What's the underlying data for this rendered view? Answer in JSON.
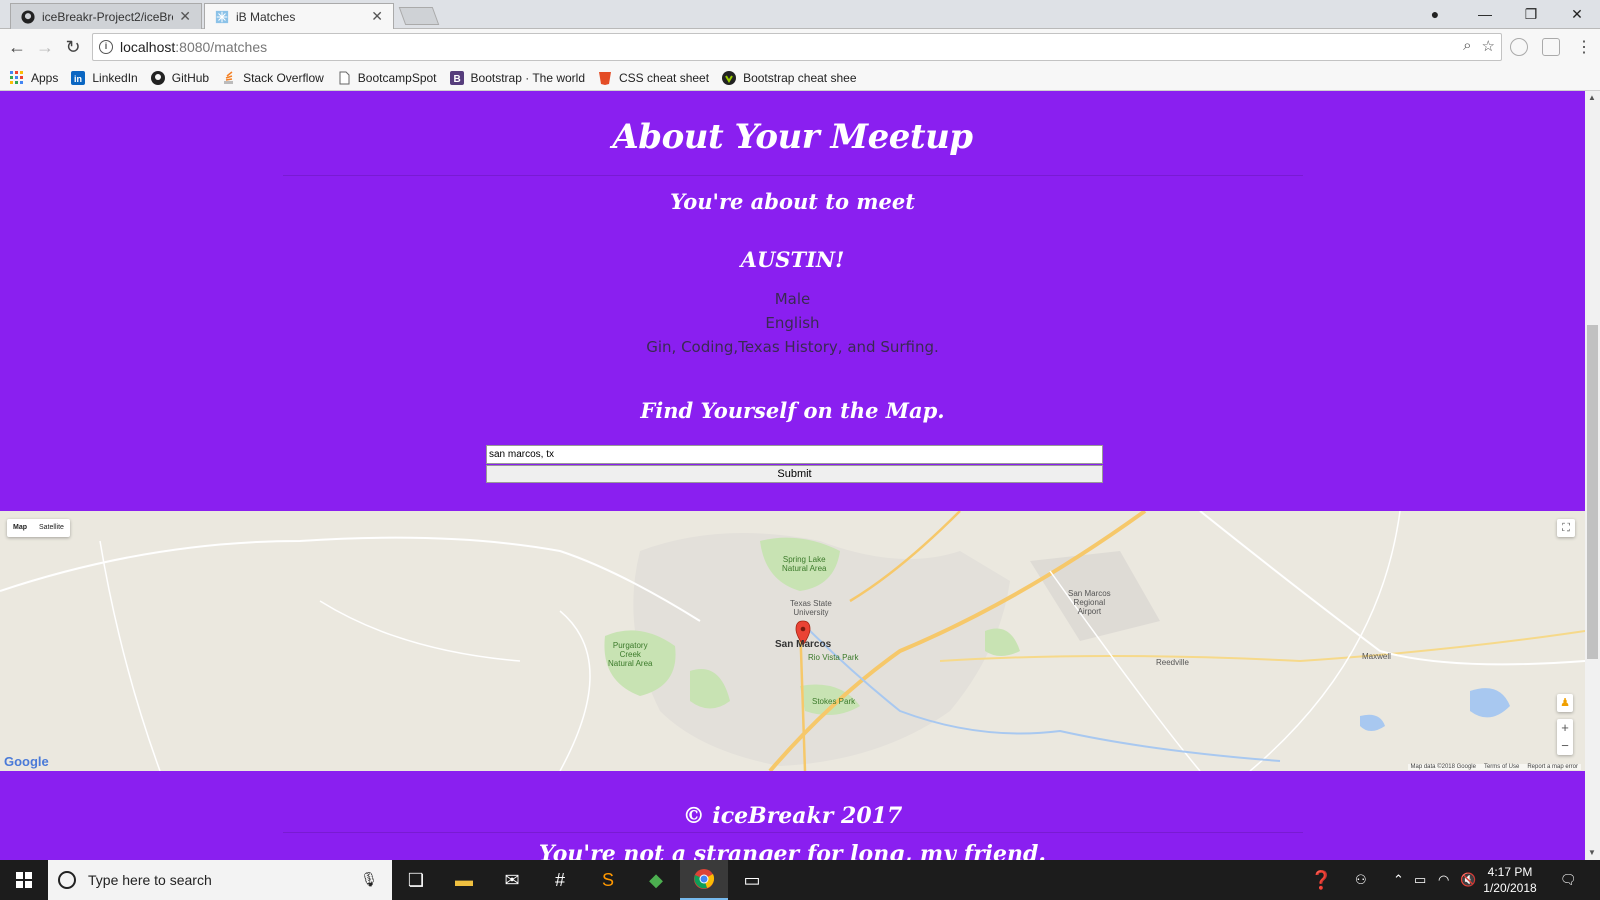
{
  "browser": {
    "tabs": [
      {
        "title": "iceBreakr-Project2/iceBre",
        "active": false
      },
      {
        "title": "iB Matches",
        "active": true
      }
    ],
    "url_host": "localhost",
    "url_rest": ":8080/matches",
    "bookmarks": [
      {
        "label": "Apps",
        "icon": "apps-grid-icon"
      },
      {
        "label": "LinkedIn",
        "icon": "linkedin-icon"
      },
      {
        "label": "GitHub",
        "icon": "github-icon"
      },
      {
        "label": "Stack Overflow",
        "icon": "stackoverflow-icon"
      },
      {
        "label": "BootcampSpot",
        "icon": "page-icon"
      },
      {
        "label": "Bootstrap · The world",
        "icon": "bootstrap-icon"
      },
      {
        "label": "CSS cheat sheet",
        "icon": "css-icon"
      },
      {
        "label": "Bootstrap cheat shee",
        "icon": "bootstrap-cheat-icon"
      }
    ]
  },
  "page": {
    "title": "About Your Meetup",
    "subtitle": "You're about to meet",
    "match_name": "AUSTIN!",
    "details": [
      "Male",
      "English",
      "Gin, Coding,Texas History, and Surfing."
    ],
    "map_heading": "Find Yourself on the Map.",
    "search_value": "san marcos, tx",
    "submit_label": "Submit",
    "footer_copy": "© iceBreakr 2017",
    "footer_tagline": "You're not a stranger for long, my friend."
  },
  "map": {
    "type_buttons": [
      "Map",
      "Satellite"
    ],
    "google_logo": "Google",
    "footer_links": [
      "Map data ©2018 Google",
      "Terms of Use",
      "Report a map error"
    ],
    "labels": {
      "spring_lake": "Spring Lake\nNatural Area",
      "texas_state": "Texas State\nUniversity",
      "san_marcos": "San Marcos",
      "rio_vista": "Rio Vista Park",
      "purgatory": "Purgatory\nCreek\nNatural Area",
      "stokes": "Stokes Park",
      "airport": "San Marcos\nRegional\nAirport",
      "reedville": "Reedville",
      "maxwell": "Maxwell"
    }
  },
  "taskbar": {
    "search_placeholder": "Type here to search",
    "time": "4:17 PM",
    "date": "1/20/2018"
  },
  "colors": {
    "page_bg": "#8a1ff0",
    "heading": "#ffffff",
    "detail_text": "#3a2a52"
  }
}
